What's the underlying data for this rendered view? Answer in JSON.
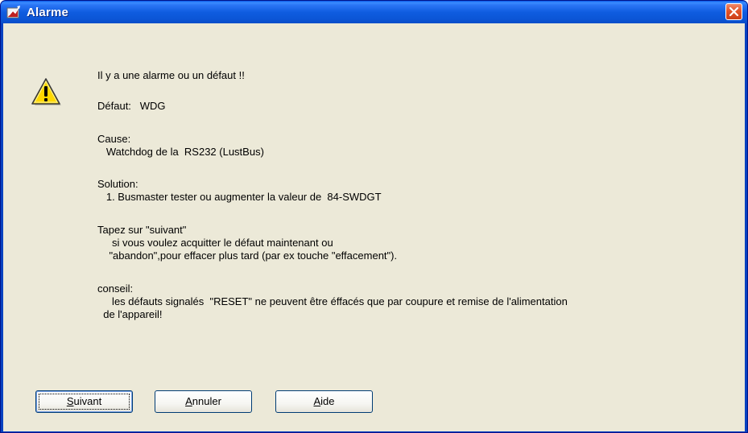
{
  "window": {
    "title": "Alarme",
    "icon": "alarm-app-icon",
    "close_icon": "close-icon"
  },
  "message": {
    "icon": "warning-icon",
    "lines": [
      "Il y a une alarme ou un défaut !!",
      "Défaut:   WDG",
      "Cause:",
      "   Watchdog de la  RS232 (LustBus)",
      "Solution:",
      "   1. Busmaster tester ou augmenter la valeur de  84-SWDGT",
      "Tapez sur \"suivant\"",
      "     si vous voulez acquitter le défaut maintenant ou",
      "    \"abandon\",pour effacer plus tard (par ex touche \"effacement\").",
      "conseil:",
      "     les défauts signalés  \"RESET\" ne peuvent être éffacés que par coupure et remise de l'alimentation",
      "  de l'appareil!"
    ]
  },
  "buttons": {
    "next": {
      "mnemonic": "S",
      "rest": "uivant"
    },
    "cancel": {
      "mnemonic": "A",
      "rest": "nnuler"
    },
    "help": {
      "mnemonic": "A",
      "rest": "ide"
    }
  },
  "colors": {
    "titlebar": "#0a5ae8",
    "dialog_background": "#ece9d8",
    "close_button": "#e2542a",
    "warning_yellow": "#ffd800"
  }
}
